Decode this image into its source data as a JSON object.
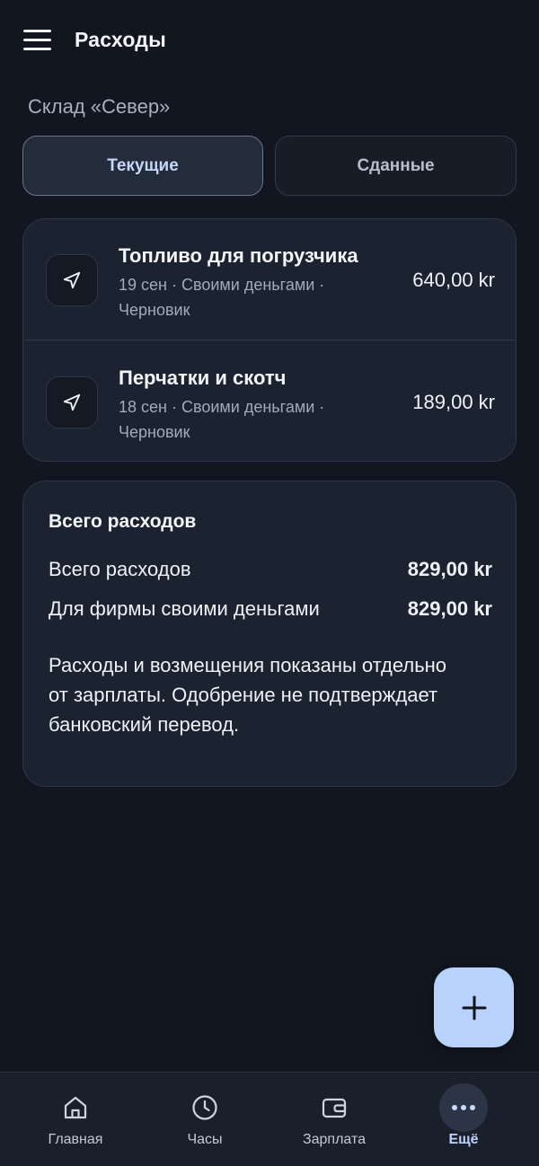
{
  "header": {
    "title": "Расходы",
    "menu_icon": "hamburger-menu-icon"
  },
  "warehouse": "Склад «Север»",
  "tabs": [
    {
      "label": "Текущие",
      "selected": true
    },
    {
      "label": "Сданные",
      "selected": false
    }
  ],
  "expenses": [
    {
      "icon": "send-arrow-icon",
      "title": "Топливо для погрузчика",
      "meta": "19 сен · Своими деньгами · Черновик",
      "amount": "640,00 kr"
    },
    {
      "icon": "send-arrow-icon",
      "title": "Перчатки и скотч",
      "meta": "18 сен · Своими деньгами · Черновик",
      "amount": "189,00 kr"
    }
  ],
  "summary": {
    "title": "Всего расходов",
    "lines": [
      {
        "label": "Всего расходов",
        "value": "829,00 kr"
      },
      {
        "label": "Для фирмы своими деньгами",
        "value": "829,00 kr"
      }
    ],
    "note": "Расходы и возмещения показаны отдельно от зарплаты. Одобрение не подтверждает банковский перевод."
  },
  "fab": {
    "icon": "plus-icon"
  },
  "bottom_nav": [
    {
      "label": "Главная",
      "icon": "home-icon",
      "active": false
    },
    {
      "label": "Часы",
      "icon": "clock-icon",
      "active": false
    },
    {
      "label": "Зарплата",
      "icon": "wallet-icon",
      "active": false
    },
    {
      "label": "Ещё",
      "icon": "more-dots-icon",
      "active": true
    }
  ],
  "colors": {
    "background": "#121620",
    "card": "#1b2230",
    "accent": "#b9d2fb",
    "tab_active_text": "#c6d7f7"
  }
}
